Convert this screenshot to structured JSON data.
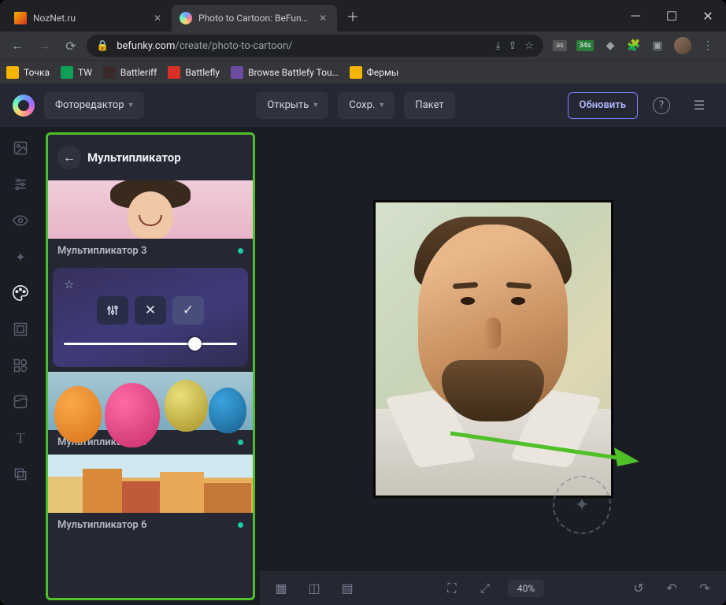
{
  "browser": {
    "tabs": [
      {
        "title": "NozNet.ru",
        "active": false
      },
      {
        "title": "Photo to Cartoon: BeFunky - Car",
        "active": true
      }
    ],
    "url_domain": "befunky.com",
    "url_path": "/create/photo-to-cartoon/"
  },
  "bookmarks": [
    {
      "label": "Точка",
      "color": "#f4b400"
    },
    {
      "label": "TW",
      "color": "#0f9d58"
    },
    {
      "label": "Battleriff",
      "color": "#3a2a2a"
    },
    {
      "label": "Battlefly",
      "color": "#d93025"
    },
    {
      "label": "Browse Battlefy Tou…",
      "color": "#6b4ca0"
    },
    {
      "label": "Фермы",
      "color": "#f4b400"
    }
  ],
  "header": {
    "editor_label": "Фоторедактор",
    "open_label": "Открыть",
    "save_label": "Сохр.",
    "batch_label": "Пакет",
    "upgrade_label": "Обновить"
  },
  "panel": {
    "title": "Мультипликатор",
    "effects": [
      {
        "label": "Мультипликатор 3"
      },
      {
        "label": "Мультипликатор 5"
      },
      {
        "label": "Мультипликатор 6"
      }
    ],
    "slider_pct": 72
  },
  "footer": {
    "zoom": "40%"
  },
  "ext_badge": "34s"
}
